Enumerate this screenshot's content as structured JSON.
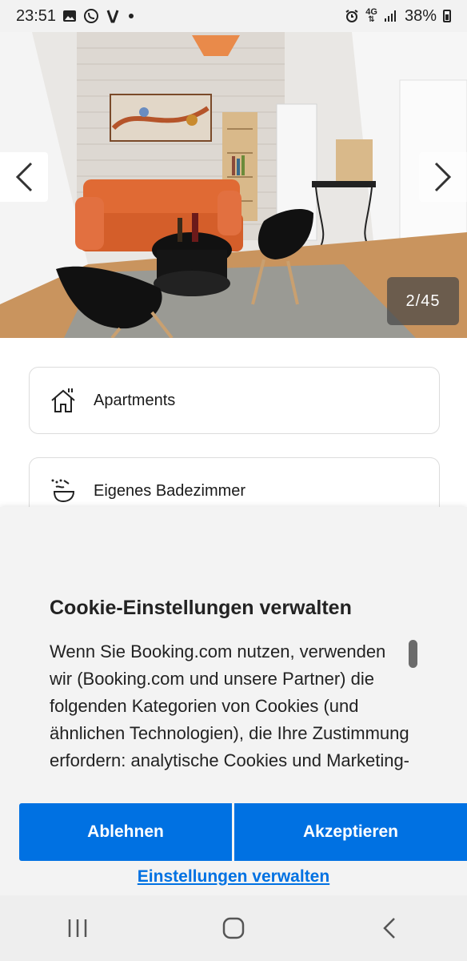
{
  "status_bar": {
    "time": "23:51",
    "network": "4G",
    "battery": "38%",
    "icons": [
      "gallery-icon",
      "viber-icon",
      "vodafone-icon",
      "dot-icon",
      "alarm-icon",
      "network-4g-icon",
      "signal-icon",
      "battery-icon"
    ]
  },
  "gallery": {
    "counter": "2/45",
    "prev_icon": "chevron-left-icon",
    "next_icon": "chevron-right-icon"
  },
  "features": [
    {
      "label": "Apartments",
      "icon": "house-icon"
    },
    {
      "label": "Eigenes Badezimmer",
      "icon": "bathtub-icon"
    }
  ],
  "cookie": {
    "title": "Cookie-Einstellungen verwalten",
    "body": "Wenn Sie Booking.com nutzen, verwenden wir (Booking.com und unsere Partner) die folgenden Kategorien von Cookies (und ähnlichen Technologien), die Ihre Zustimmung erfordern: analytische Cookies und Marketing-",
    "reject_label": "Ablehnen",
    "accept_label": "Akzeptieren",
    "manage_label": "Einstellungen verwalten"
  },
  "colors": {
    "accent": "#0071e2",
    "sheet_bg": "#f3f3f3"
  },
  "nav_bar": {
    "icons": [
      "recent-apps-icon",
      "home-icon",
      "back-icon"
    ]
  }
}
